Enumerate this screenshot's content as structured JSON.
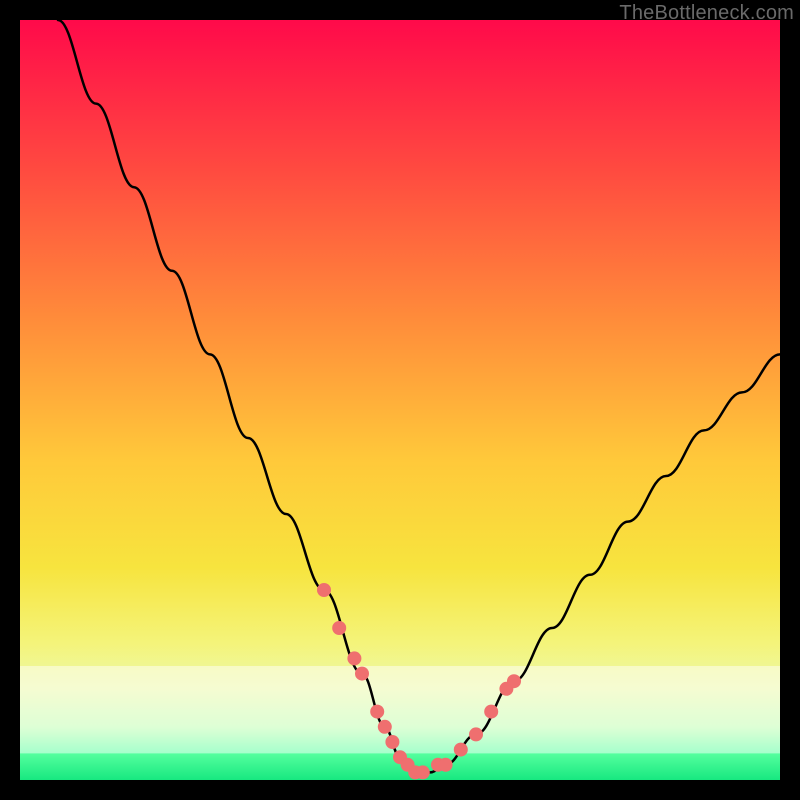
{
  "watermark": "TheBottleneck.com",
  "chart_data": {
    "type": "line",
    "title": "",
    "xlabel": "",
    "ylabel": "",
    "xlim": [
      0,
      100
    ],
    "ylim": [
      0,
      100
    ],
    "grid": false,
    "series": [
      {
        "name": "bottleneck-curve",
        "x": [
          5,
          10,
          15,
          20,
          25,
          30,
          35,
          40,
          45,
          48,
          50,
          52,
          54,
          56,
          60,
          65,
          70,
          75,
          80,
          85,
          90,
          95,
          100
        ],
        "y": [
          100,
          89,
          78,
          67,
          56,
          45,
          35,
          25,
          14,
          7,
          3,
          1,
          1,
          2,
          6,
          13,
          20,
          27,
          34,
          40,
          46,
          51,
          56
        ]
      }
    ],
    "markers": {
      "name": "highlight-points",
      "x": [
        40,
        42,
        44,
        45,
        47,
        48,
        49,
        50,
        51,
        52,
        53,
        55,
        56,
        58,
        60,
        62,
        64,
        65
      ],
      "y": [
        25,
        20,
        16,
        14,
        9,
        7,
        5,
        3,
        2,
        1,
        1,
        2,
        2,
        4,
        6,
        9,
        12,
        13
      ]
    },
    "gradient_stops": [
      {
        "offset": 0.0,
        "color": "#ff0a4a"
      },
      {
        "offset": 0.2,
        "color": "#ff4b40"
      },
      {
        "offset": 0.4,
        "color": "#ff8e3a"
      },
      {
        "offset": 0.58,
        "color": "#ffc93a"
      },
      {
        "offset": 0.72,
        "color": "#f7e43e"
      },
      {
        "offset": 0.82,
        "color": "#f4f47a"
      },
      {
        "offset": 0.88,
        "color": "#ecf9a8"
      },
      {
        "offset": 0.93,
        "color": "#bfffaf"
      },
      {
        "offset": 0.965,
        "color": "#55ff9e"
      },
      {
        "offset": 1.0,
        "color": "#17e880"
      }
    ],
    "band_below_y": 15,
    "marker_color": "#ef6f6f",
    "curve_color": "#000000"
  }
}
